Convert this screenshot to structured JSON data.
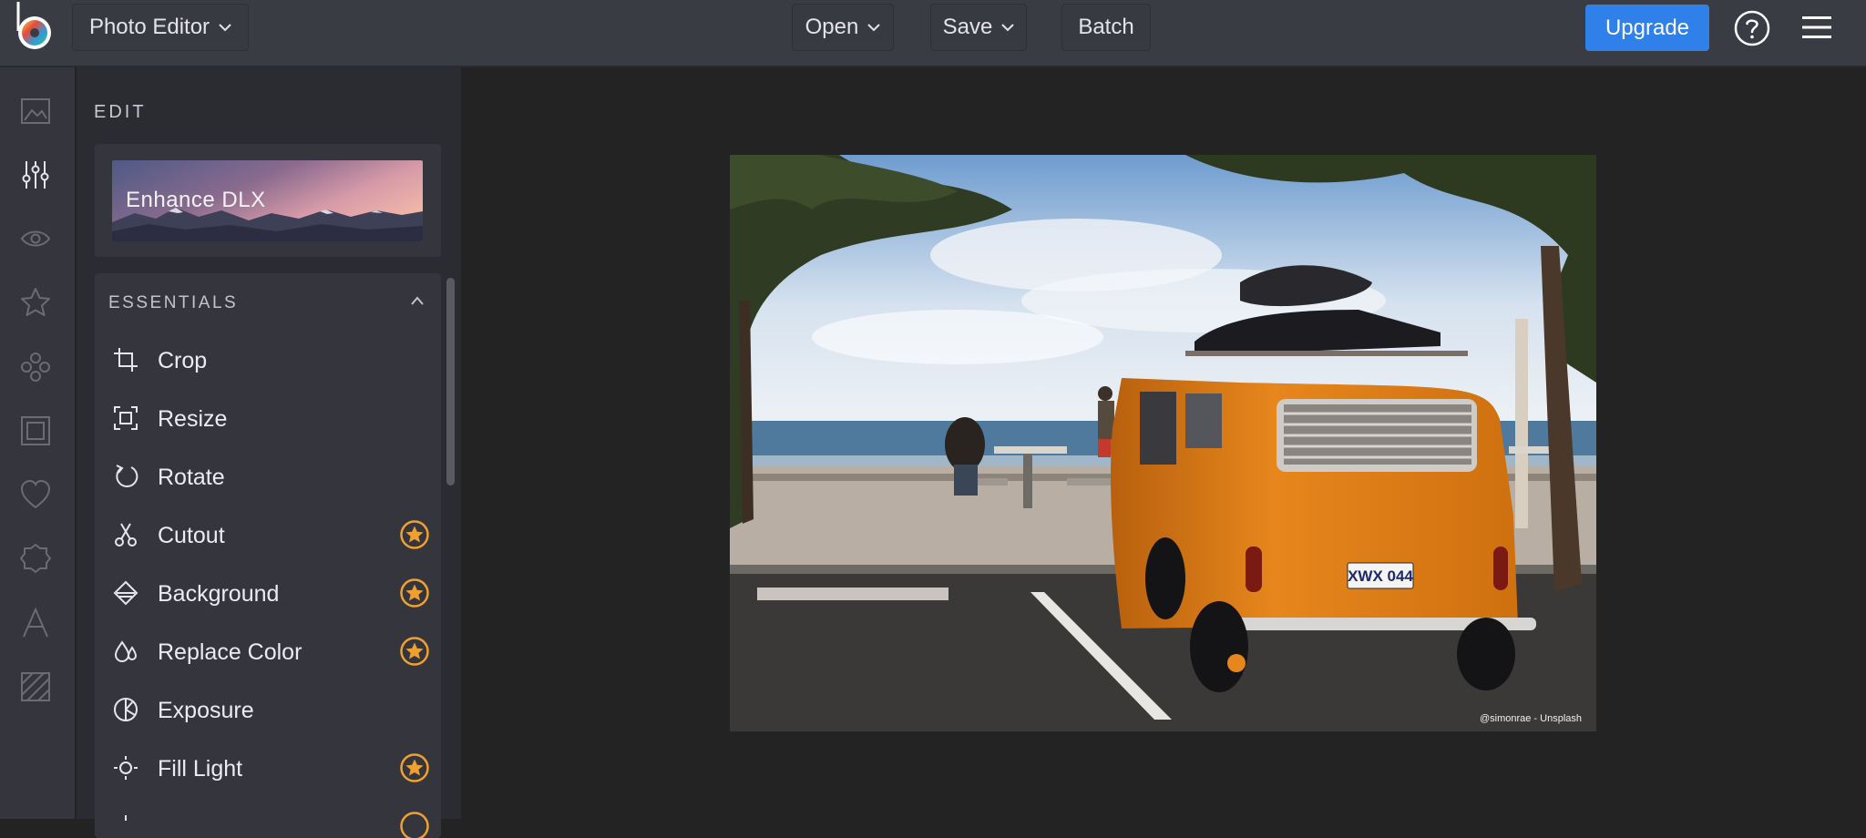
{
  "topbar": {
    "app_menu_label": "Photo Editor",
    "open_label": "Open",
    "save_label": "Save",
    "batch_label": "Batch",
    "upgrade_label": "Upgrade"
  },
  "rail": {
    "items": [
      "image-icon",
      "sliders-icon",
      "eye-icon",
      "star-icon",
      "touch-up-icon",
      "frame-icon",
      "heart-icon",
      "badge-icon",
      "text-icon",
      "texture-icon"
    ]
  },
  "panel": {
    "heading": "EDIT",
    "enhance_label": "Enhance DLX",
    "section_title": "ESSENTIALS",
    "tools": [
      {
        "label": "Crop",
        "icon": "crop-icon",
        "premium": false
      },
      {
        "label": "Resize",
        "icon": "resize-icon",
        "premium": false
      },
      {
        "label": "Rotate",
        "icon": "rotate-icon",
        "premium": false
      },
      {
        "label": "Cutout",
        "icon": "scissors-icon",
        "premium": true
      },
      {
        "label": "Background",
        "icon": "background-icon",
        "premium": true
      },
      {
        "label": "Replace Color",
        "icon": "droplets-icon",
        "premium": true
      },
      {
        "label": "Exposure",
        "icon": "exposure-icon",
        "premium": false
      },
      {
        "label": "Fill Light",
        "icon": "fill-light-icon",
        "premium": true
      }
    ]
  },
  "canvas": {
    "photo_credit": "@simonrae - Unsplash",
    "license_plate": "XWX 044"
  },
  "colors": {
    "accent": "#2f80e8",
    "premium_star": "#f0a030",
    "van": "#e6861c"
  }
}
